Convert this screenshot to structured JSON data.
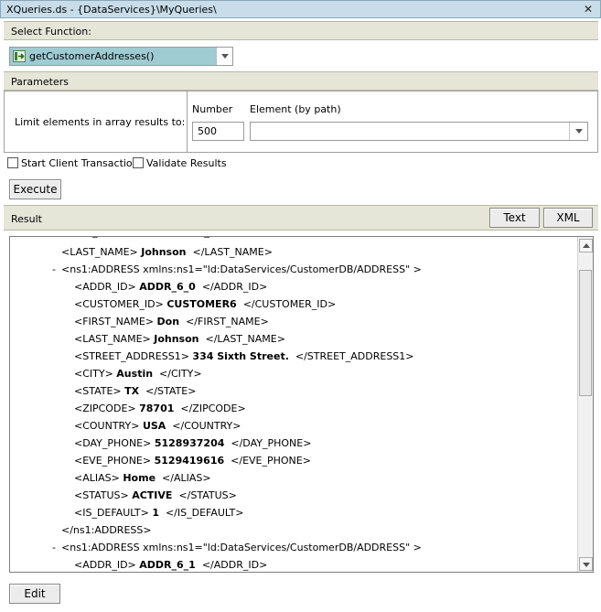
{
  "window": {
    "title": "XQueries.ds - {DataServices}\\MyQueries\\"
  },
  "select_function": {
    "header": "Select Function:",
    "selected": "getCustomerAddresses()"
  },
  "parameters": {
    "header": "Parameters",
    "limit_label": "Limit elements in array results to:",
    "number_label": "Number",
    "number_value": "500",
    "element_label": "Element (by path)",
    "element_value": ""
  },
  "options": {
    "start_client_transaction": "Start Client Transaction",
    "validate_results": "Validate Results"
  },
  "execute_label": "Execute",
  "result": {
    "header": "Result",
    "text_button": "Text",
    "xml_button": "XML",
    "lines": [
      {
        "indent": 1,
        "toggle": "",
        "open": "<LAST_NAME>",
        "value": "Johnson",
        "close": "</LAST_NAME>"
      },
      {
        "indent": 0,
        "toggle": "-",
        "open": "<ns1:ADDRESS xmlns:ns1=\"ld:DataServices/CustomerDB/ADDRESS\" >",
        "value": "",
        "close": ""
      },
      {
        "indent": 2,
        "toggle": "",
        "open": "<ADDR_ID>",
        "value": "ADDR_6_0",
        "close": "</ADDR_ID>"
      },
      {
        "indent": 2,
        "toggle": "",
        "open": "<CUSTOMER_ID>",
        "value": "CUSTOMER6",
        "close": "</CUSTOMER_ID>"
      },
      {
        "indent": 2,
        "toggle": "",
        "open": "<FIRST_NAME>",
        "value": "Don",
        "close": "</FIRST_NAME>"
      },
      {
        "indent": 2,
        "toggle": "",
        "open": "<LAST_NAME>",
        "value": "Johnson",
        "close": "</LAST_NAME>"
      },
      {
        "indent": 2,
        "toggle": "",
        "open": "<STREET_ADDRESS1>",
        "value": "334 Sixth Street.",
        "close": "</STREET_ADDRESS1>"
      },
      {
        "indent": 2,
        "toggle": "",
        "open": "<CITY>",
        "value": "Austin",
        "close": "</CITY>"
      },
      {
        "indent": 2,
        "toggle": "",
        "open": "<STATE>",
        "value": "TX",
        "close": "</STATE>"
      },
      {
        "indent": 2,
        "toggle": "",
        "open": "<ZIPCODE>",
        "value": "78701",
        "close": "</ZIPCODE>"
      },
      {
        "indent": 2,
        "toggle": "",
        "open": "<COUNTRY>",
        "value": "USA",
        "close": "</COUNTRY>"
      },
      {
        "indent": 2,
        "toggle": "",
        "open": "<DAY_PHONE>",
        "value": "5128937204",
        "close": "</DAY_PHONE>"
      },
      {
        "indent": 2,
        "toggle": "",
        "open": "<EVE_PHONE>",
        "value": "5129419616",
        "close": "</EVE_PHONE>"
      },
      {
        "indent": 2,
        "toggle": "",
        "open": "<ALIAS>",
        "value": "Home",
        "close": "</ALIAS>"
      },
      {
        "indent": 2,
        "toggle": "",
        "open": "<STATUS>",
        "value": "ACTIVE",
        "close": "</STATUS>"
      },
      {
        "indent": 2,
        "toggle": "",
        "open": "<IS_DEFAULT>",
        "value": "1",
        "close": "</IS_DEFAULT>"
      },
      {
        "indent": 1,
        "toggle": "",
        "open": "</ns1:ADDRESS>",
        "value": "",
        "close": ""
      },
      {
        "indent": 0,
        "toggle": "-",
        "open": "<ns1:ADDRESS xmlns:ns1=\"ld:DataServices/CustomerDB/ADDRESS\" >",
        "value": "",
        "close": ""
      },
      {
        "indent": 2,
        "toggle": "",
        "open": "<ADDR_ID>",
        "value": "ADDR_6_1",
        "close": "</ADDR_ID>"
      }
    ]
  },
  "edit_label": "Edit",
  "icons": {
    "close": "close-icon",
    "function": "function-arrow-icon",
    "dropdown": "chevron-down-icon",
    "scroll_up": "scroll-up-icon",
    "scroll_down": "scroll-down-icon"
  },
  "colors": {
    "titlebar": "#c8dde9",
    "section_header": "#e6e6d8",
    "selected_function": "#9fcbd2"
  }
}
